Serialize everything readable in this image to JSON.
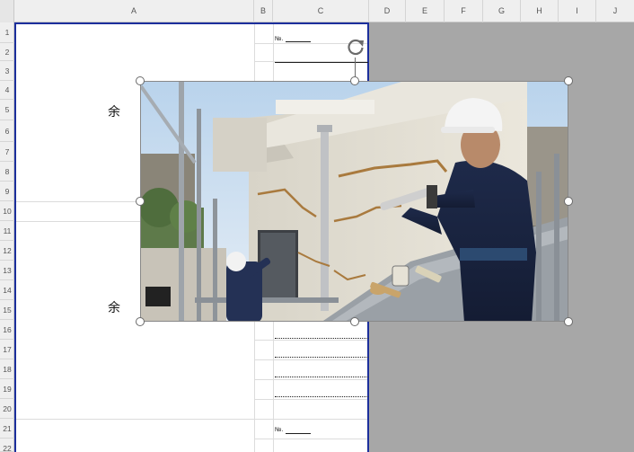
{
  "sheet": {
    "columns": [
      "A",
      "B",
      "C",
      "D",
      "E",
      "F",
      "G",
      "H",
      "I",
      "J"
    ],
    "rows": [
      "1",
      "2",
      "3",
      "4",
      "5",
      "6",
      "7",
      "8",
      "9",
      "10",
      "11",
      "12",
      "13",
      "14",
      "15",
      "16",
      "17",
      "18",
      "19",
      "20",
      "21",
      "22"
    ]
  },
  "cells": {
    "a5_text": "余",
    "a15_text": "余",
    "c1_text": "№.",
    "c21_text": "№."
  },
  "picture": {
    "description_icon": "photo-image",
    "rotate_icon": "rotate-handle-icon"
  }
}
